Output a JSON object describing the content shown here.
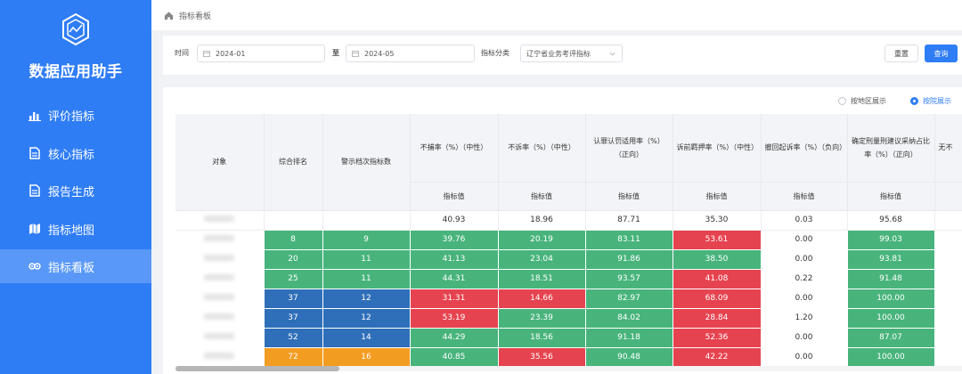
{
  "sidebar": {
    "app_title": "数据应用助手",
    "items": [
      {
        "label": "评价指标",
        "icon": "bar-chart-icon"
      },
      {
        "label": "核心指标",
        "icon": "document-icon"
      },
      {
        "label": "报告生成",
        "icon": "document-icon"
      },
      {
        "label": "指标地图",
        "icon": "map-icon"
      },
      {
        "label": "指标看板",
        "icon": "eye-icon",
        "active": true
      }
    ]
  },
  "breadcrumb": {
    "label": "指标看板"
  },
  "filter": {
    "time_label": "时间",
    "start_value": "2024-01",
    "to_label": "至",
    "end_value": "2024-05",
    "category_label": "指标分类",
    "category_value": "辽宁省业务考评指标",
    "reset_label": "重置",
    "search_label": "查询"
  },
  "view": {
    "by_region": "按地区展示",
    "by_court": "按院展示"
  },
  "table": {
    "headers": {
      "object": "对象",
      "rank": "综合排名",
      "alerts": "警示档次指标数",
      "m1": "不捕率（%）（中性）",
      "m2": "不诉率（%）（中性）",
      "m3": "认罪认罚适用率（%）（正向）",
      "m4": "诉前羁押率（%）（中性）",
      "m5": "撤回起诉率（%）（负向）",
      "m6": "确定刑量刑建议采纳占比率（%）（正向）",
      "m7": "无不"
    },
    "sub_header": "指标值",
    "base_row": [
      "40.93",
      "18.96",
      "87.71",
      "35.30",
      "0.03",
      "95.68"
    ],
    "rows": [
      {
        "rank": "8",
        "alerts": "9",
        "values": [
          "39.76",
          "20.19",
          "83.11",
          "53.61",
          "0.00",
          "99.03"
        ]
      },
      {
        "rank": "20",
        "alerts": "11",
        "values": [
          "41.13",
          "23.04",
          "91.86",
          "38.50",
          "0.00",
          "93.81"
        ]
      },
      {
        "rank": "25",
        "alerts": "11",
        "values": [
          "44.31",
          "18.51",
          "93.57",
          "41.08",
          "0.22",
          "91.48"
        ]
      },
      {
        "rank": "37",
        "alerts": "12",
        "values": [
          "31.31",
          "14.66",
          "82.97",
          "68.09",
          "0.00",
          "100.00"
        ]
      },
      {
        "rank": "37",
        "alerts": "12",
        "values": [
          "53.19",
          "23.39",
          "84.02",
          "28.84",
          "1.20",
          "100.00"
        ]
      },
      {
        "rank": "52",
        "alerts": "14",
        "values": [
          "44.29",
          "18.56",
          "91.18",
          "52.36",
          "0.00",
          "87.07"
        ]
      },
      {
        "rank": "72",
        "alerts": "16",
        "values": [
          "40.85",
          "35.56",
          "90.48",
          "42.22",
          "0.00",
          "100.00"
        ]
      }
    ]
  },
  "colors": {
    "sidebar": "#2f7df5",
    "green": "#48b47c",
    "red": "#e5434f",
    "blue": "#2f6fb9",
    "orange": "#f39c22"
  }
}
